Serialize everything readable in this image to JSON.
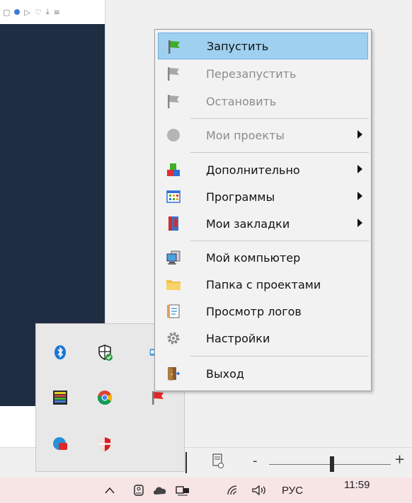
{
  "context_menu": {
    "items": [
      {
        "label": "Запустить",
        "icon": "green-flag-icon",
        "state": "highlighted"
      },
      {
        "label": "Перезапустить",
        "icon": "gray-flag-icon",
        "state": "disabled"
      },
      {
        "label": "Остановить",
        "icon": "gray-flag-icon",
        "state": "disabled"
      },
      {
        "label": "Мои проекты",
        "icon": "gray-circle-icon",
        "state": "disabled",
        "submenu": true
      },
      {
        "label": "Дополнительно",
        "icon": "colored-blocks-icon",
        "state": "enabled",
        "submenu": true
      },
      {
        "label": "Программы",
        "icon": "app-grid-icon",
        "state": "enabled",
        "submenu": true
      },
      {
        "label": "Мои закладки",
        "icon": "book-icon",
        "state": "enabled",
        "submenu": true
      },
      {
        "label": "Мой компьютер",
        "icon": "computer-icon",
        "state": "enabled"
      },
      {
        "label": "Папка с проектами",
        "icon": "folder-icon",
        "state": "enabled"
      },
      {
        "label": "Просмотр логов",
        "icon": "log-document-icon",
        "state": "enabled"
      },
      {
        "label": "Настройки",
        "icon": "gear-icon",
        "state": "enabled"
      },
      {
        "label": "Выход",
        "icon": "exit-door-icon",
        "state": "enabled"
      }
    ]
  },
  "tray_popup": {
    "icons": [
      "bluetooth-icon",
      "defender-shield-icon",
      "app-tray-icon",
      "grid-app-icon",
      "chrome-icon",
      "red-flag-icon",
      "red-app-icon",
      "shield-icon"
    ]
  },
  "statusbar": {
    "zoom_minus": "-",
    "zoom_plus": "+",
    "zoom_level": 0.52
  },
  "taskbar": {
    "language": "РУС",
    "time": "11:59",
    "icons": [
      "chevron-up-icon",
      "meet-now-icon",
      "cloud-icon",
      "network-icon",
      "wifi-icon",
      "volume-icon"
    ]
  },
  "colors": {
    "highlight": "#9fd0f0",
    "dark_panel": "#1f2d42",
    "taskbar": "#f7e4e5"
  }
}
